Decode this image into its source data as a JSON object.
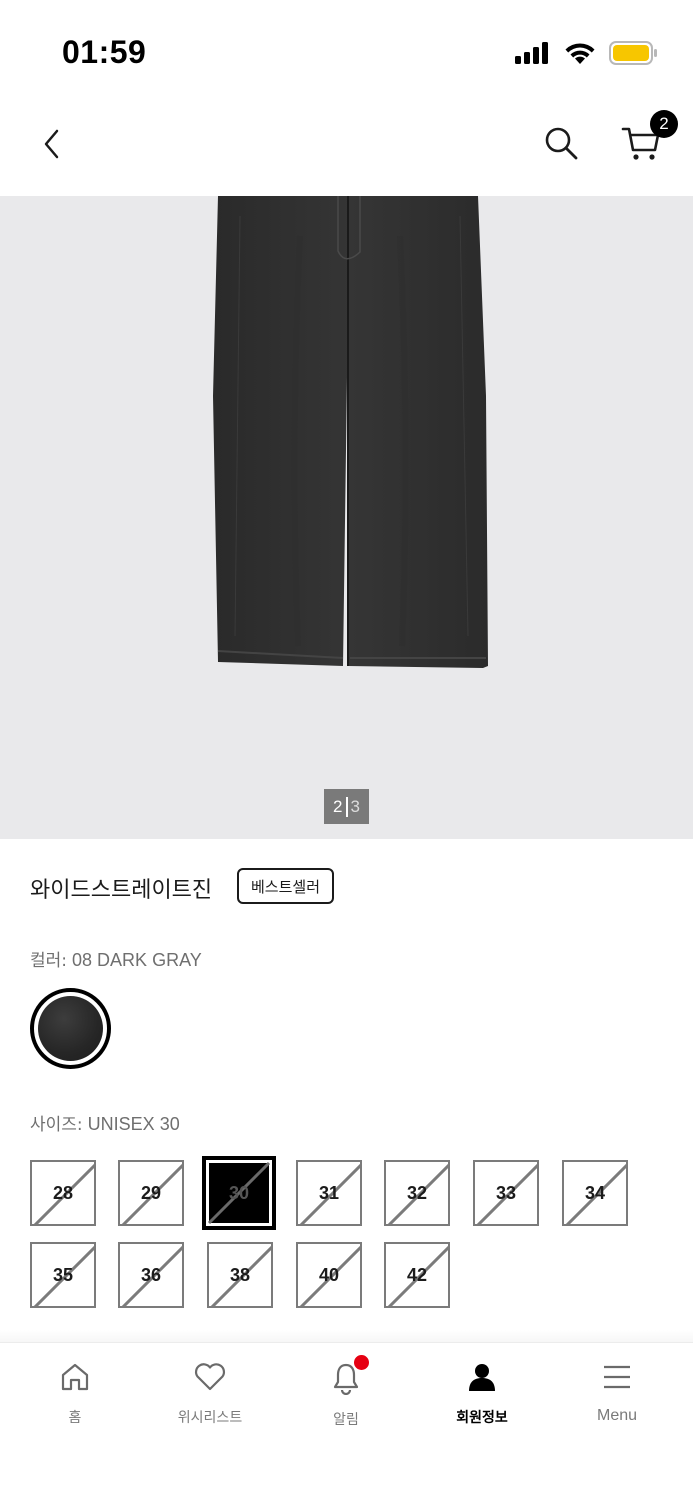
{
  "status_bar": {
    "time": "01:59",
    "battery_color": "#f7c600"
  },
  "header": {
    "back_icon": "chevron-left-icon",
    "search_icon": "search-icon",
    "cart_icon": "cart-icon",
    "cart_count": "2"
  },
  "gallery": {
    "current": "2",
    "total": "3",
    "background": "#e9e9eb"
  },
  "product": {
    "name": "와이드스트레이트진",
    "badge": "베스트셀러",
    "color_label": "컬러:",
    "color_value": "08 DARK GRAY",
    "swatch_color": "#262626",
    "size_label": "사이즈:",
    "size_value": "UNISEX 30",
    "sizes": [
      {
        "label": "28",
        "available": false,
        "selected": false
      },
      {
        "label": "29",
        "available": false,
        "selected": false
      },
      {
        "label": "30",
        "available": false,
        "selected": true
      },
      {
        "label": "31",
        "available": false,
        "selected": false
      },
      {
        "label": "32",
        "available": false,
        "selected": false
      },
      {
        "label": "33",
        "available": false,
        "selected": false
      },
      {
        "label": "34",
        "available": false,
        "selected": false
      },
      {
        "label": "35",
        "available": false,
        "selected": false
      },
      {
        "label": "36",
        "available": false,
        "selected": false
      },
      {
        "label": "38",
        "available": false,
        "selected": false
      },
      {
        "label": "40",
        "available": false,
        "selected": false
      },
      {
        "label": "42",
        "available": false,
        "selected": false
      }
    ]
  },
  "bottom_nav": {
    "items": [
      {
        "label": "홈",
        "icon": "home-icon",
        "active": false
      },
      {
        "label": "위시리스트",
        "icon": "heart-icon",
        "active": false
      },
      {
        "label": "알림",
        "icon": "bell-icon",
        "active": false,
        "dot_color": "#e60012"
      },
      {
        "label": "회원정보",
        "icon": "user-icon",
        "active": true
      },
      {
        "label": "Menu",
        "icon": "menu-icon",
        "active": false
      }
    ]
  }
}
